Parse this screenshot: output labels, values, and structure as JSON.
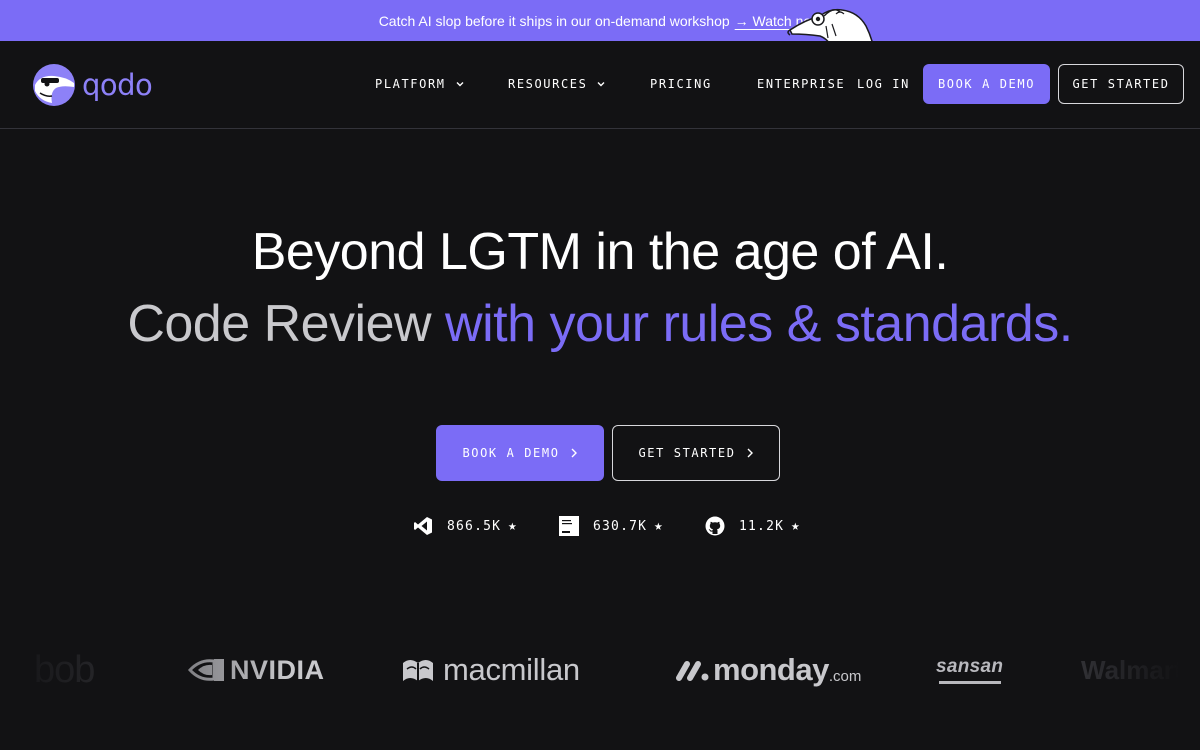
{
  "banner": {
    "text": "Catch AI slop before it ships in our on-demand workshop",
    "link": "→ Watch now"
  },
  "header": {
    "logo_text": "qodo",
    "nav": [
      {
        "label": "PLATFORM",
        "has_dropdown": true
      },
      {
        "label": "RESOURCES",
        "has_dropdown": true
      },
      {
        "label": "PRICING",
        "has_dropdown": false
      },
      {
        "label": "ENTERPRISE",
        "has_dropdown": false
      }
    ],
    "login": "LOG IN",
    "book_demo": "BOOK A DEMO",
    "get_started": "GET STARTED"
  },
  "hero": {
    "line1": "Beyond LGTM in the age of AI.",
    "line2_plain": "Code Review ",
    "line2_accent": "with your rules & standards."
  },
  "cta": {
    "book_demo": "BOOK A DEMO",
    "get_started": "GET STARTED"
  },
  "stats": [
    {
      "icon": "vscode-icon",
      "value": "866.5K",
      "star": "★"
    },
    {
      "icon": "jetbrains-icon",
      "value": "630.7K",
      "star": "★"
    },
    {
      "icon": "github-icon",
      "value": "11.2K",
      "star": "★"
    }
  ],
  "brands": {
    "bob": "bob",
    "nvidia": "NVIDIA",
    "macmillan": "macmillan",
    "monday": "monday",
    "monday_suffix": ".com",
    "sansan": "sansan",
    "walmart": "Walmart"
  },
  "colors": {
    "accent": "#7b6cf6",
    "background": "#121214",
    "banner": "#7b6cf6"
  }
}
